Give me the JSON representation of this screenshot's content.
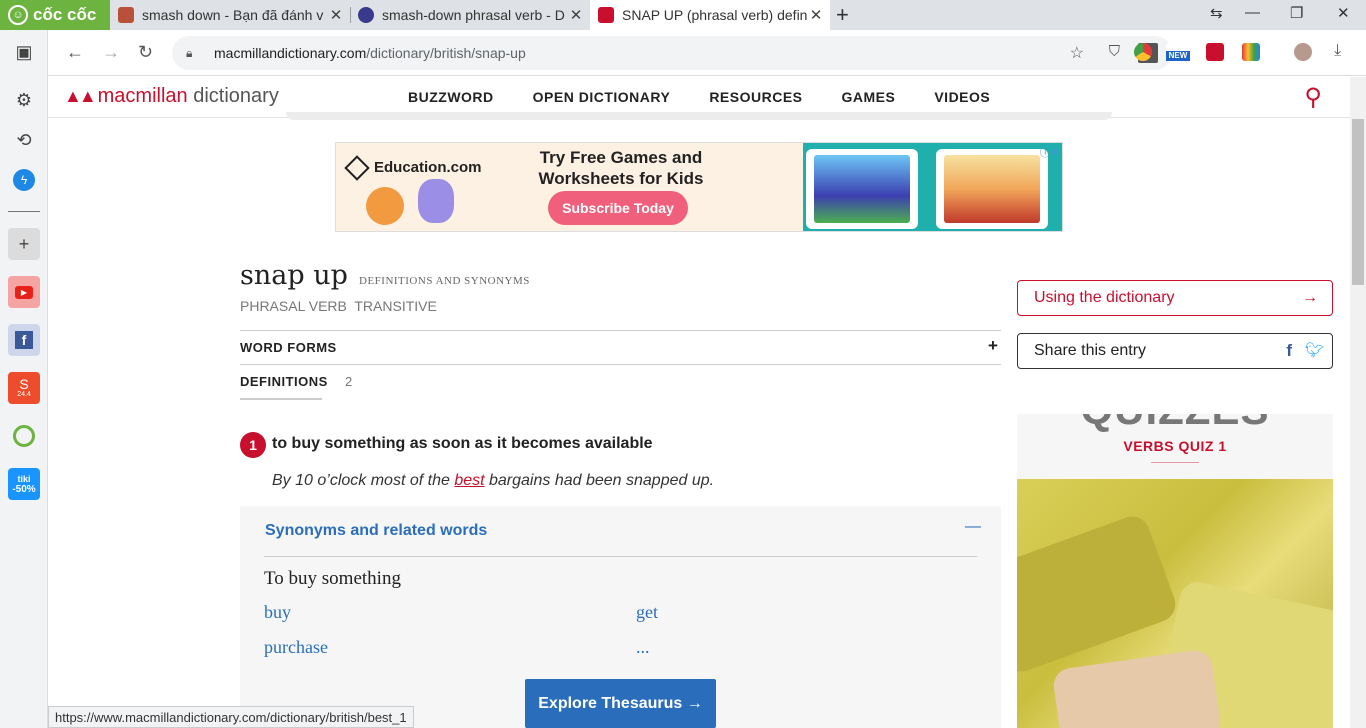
{
  "browser": {
    "brand": "cốc cốc",
    "tabs": [
      {
        "title": "smash down - Bạn đã đánh v",
        "close": "✕"
      },
      {
        "title": "smash-down phrasal verb - D",
        "close": "✕"
      },
      {
        "title": "SNAP UP (phrasal verb) defini",
        "close": "✕"
      }
    ],
    "new_tab": "+",
    "url_host": "macmillandictionary.com",
    "url_path": "/dictionary/british/snap-up",
    "ext_badge": "NEW",
    "status_url": "https://www.macmillandictionary.com/dictionary/british/best_1"
  },
  "sidebar": {
    "promo_label": "-50%",
    "tiki_label": "tiki",
    "shopee_badge": "24.4"
  },
  "site": {
    "logo_text": "macmillan",
    "logo_suffix": " dictionary",
    "nav": [
      "BUZZWORD",
      "OPEN DICTIONARY",
      "RESOURCES",
      "GAMES",
      "VIDEOS"
    ]
  },
  "ad": {
    "brand": "Education.com",
    "headline": "Try Free Games and Worksheets for Kids",
    "cta": "Subscribe Today"
  },
  "entry": {
    "headword": "snap up",
    "headword_note": "DEFINITIONS AND SYNONYMS",
    "pos": "PHRASAL VERB  TRANSITIVE",
    "word_forms_label": "WORD FORMS",
    "definitions_label": "DEFINITIONS",
    "definitions_count": "2",
    "sense_number": "1",
    "sense_definition": "to buy something as soon as it becomes available",
    "example_before": "By 10 o’clock most of the ",
    "example_link": "best",
    "example_after": " bargains had been snapped up."
  },
  "synonyms": {
    "heading": "Synonyms and related words",
    "group": "To buy something",
    "words": [
      "buy",
      "get",
      "purchase",
      "..."
    ],
    "explore": "Explore Thesaurus →"
  },
  "right": {
    "using": "Using the dictionary",
    "using_arrow": "→",
    "share": "Share this entry",
    "quiz_title": "QUIZZES",
    "quiz_sub": "VERBS QUIZ 1"
  },
  "colors": {
    "brand_red": "#c8102e",
    "link_blue": "#2a6ebb",
    "coccoc_green": "#6db33f"
  }
}
